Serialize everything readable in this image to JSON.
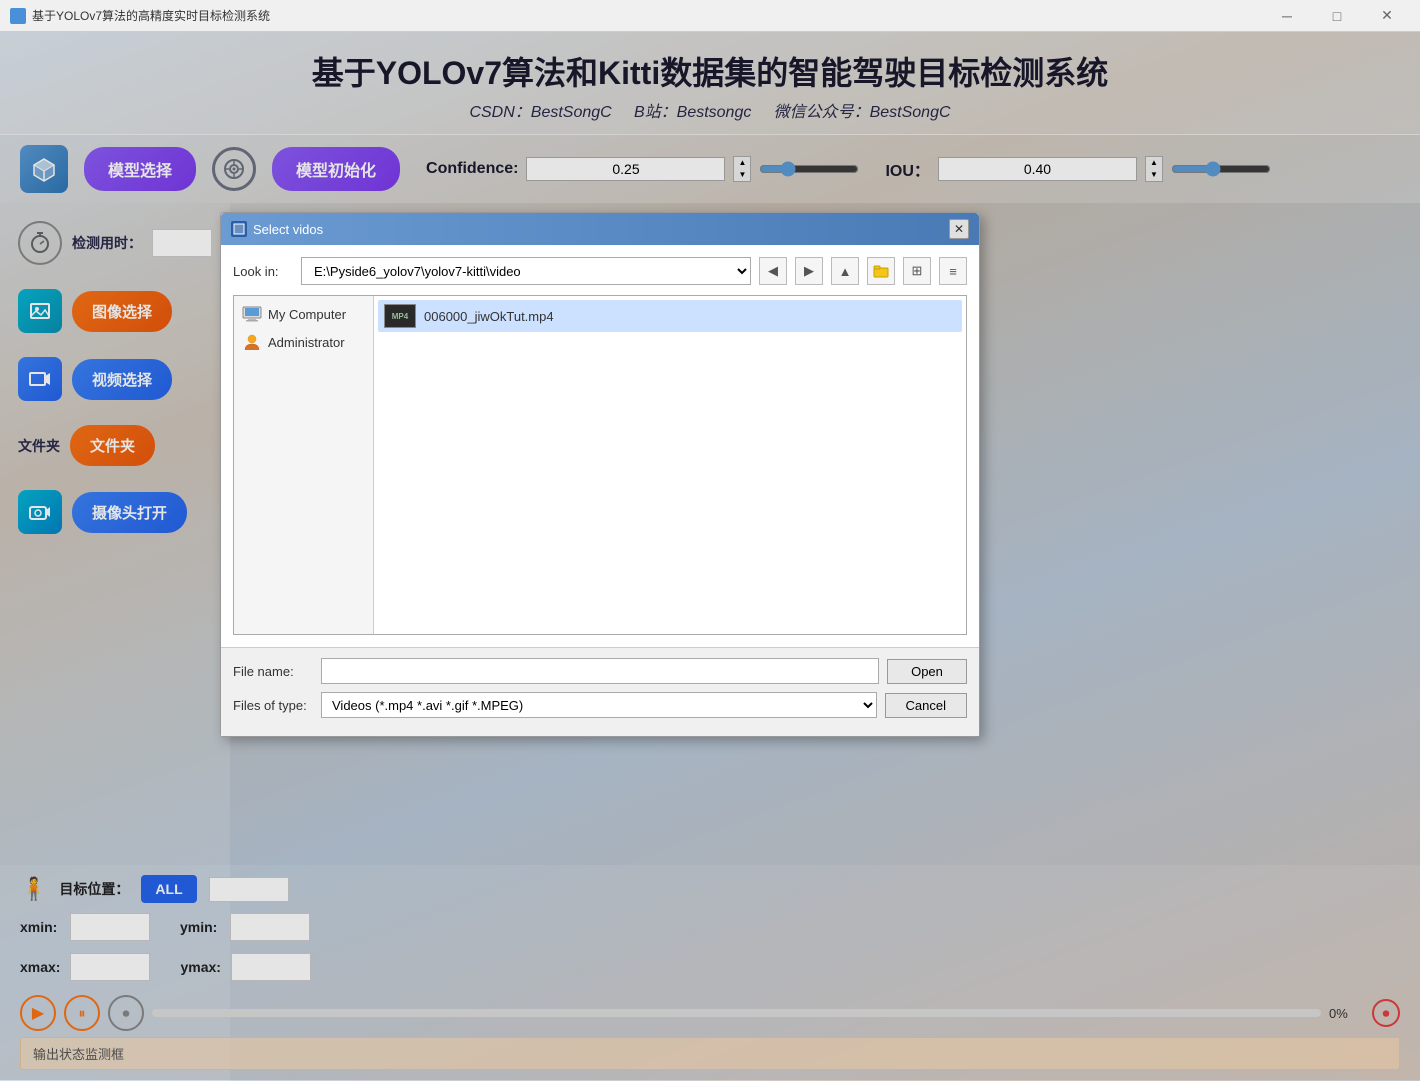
{
  "window": {
    "title": "基于YOLOv7算法的高精度实时目标检测系统",
    "min_btn": "─",
    "max_btn": "□",
    "close_btn": "✕"
  },
  "header": {
    "title": "基于YOLOv7算法和Kitti数据集的智能驾驶目标检测系统",
    "subtitle_csdn": "CSDN：BestSongC",
    "subtitle_b": "B站：Bestsongc",
    "subtitle_wx": "微信公众号：BestSongC"
  },
  "toolbar": {
    "model_select_label": "模型选择",
    "model_init_label": "模型初始化",
    "confidence_label": "Confidence:",
    "confidence_value": "0.25",
    "iou_label": "IOU：",
    "iou_value": "0.40"
  },
  "sidebar": {
    "detect_time_label": "检测用时：",
    "image_select_label": "图像选择",
    "video_select_label": "视频选择",
    "folder_label": "文件夹",
    "folder_btn_label": "文件夹",
    "camera_label": "摄像头打开"
  },
  "bottom": {
    "target_position_label": "目标位置：",
    "all_btn": "ALL",
    "xmin_label": "xmin:",
    "ymin_label": "ymin:",
    "xmax_label": "xmax:",
    "ymax_label": "ymax:",
    "progress_pct": "0%",
    "status_placeholder": "输出状态监测框"
  },
  "dialog": {
    "title": "Select vidos",
    "look_in_label": "Look in:",
    "path": "E:\\Pyside6_yolov7\\yolov7-kitti\\video",
    "tree_items": [
      {
        "label": "My Computer",
        "type": "computer",
        "selected": false
      },
      {
        "label": "Administrator",
        "type": "person",
        "selected": false
      }
    ],
    "file_items": [
      {
        "label": "006000_jiwOkTut.mp4",
        "type": "video",
        "selected": false
      }
    ],
    "file_name_label": "File name:",
    "file_name_value": "",
    "files_of_type_label": "Files of type:",
    "files_of_type_value": "Videos (*.mp4 *.avi *.gif *.MPEG)",
    "open_btn": "Open",
    "cancel_btn": "Cancel"
  }
}
